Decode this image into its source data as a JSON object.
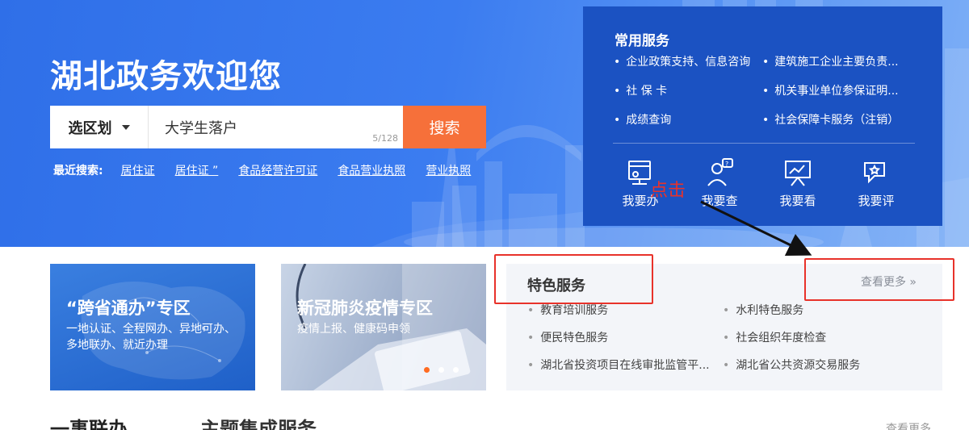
{
  "hero": {
    "title": "湖北政务欢迎您",
    "region_label": "选区划",
    "search_value": "大学生落户",
    "char_counter": "5/128",
    "search_button": "搜索",
    "recent_label": "最近搜索:",
    "recent_items": [
      "居住证",
      "居住证 ”",
      "食品经营许可证",
      "食品营业执照",
      "营业执照"
    ]
  },
  "services": {
    "title": "常用服务",
    "links": [
      "企业政策支持、信息咨询",
      "建筑施工企业主要负责...",
      "社 保 卡",
      "机关事业单位参保证明...",
      "成绩查询",
      "社会保障卡服务（注销）"
    ],
    "actions": [
      "我要办",
      "我要查",
      "我要看",
      "我要评"
    ]
  },
  "annotation": {
    "click_text": "点击",
    "color": "#e8322a"
  },
  "cards": {
    "cross": {
      "title": "“跨省通办”专区",
      "desc": "一地认证、全程网办、异地可办、多地联办、就近办理"
    },
    "covid": {
      "title": "新冠肺炎疫情专区",
      "desc": "疫情上报、健康码申领"
    }
  },
  "feature": {
    "title": "特色服务",
    "more": "查看更多 »",
    "items": [
      "教育培训服务",
      "水利特色服务",
      "便民特色服务",
      "社会组织年度检查",
      "湖北省投资项目在线审批监管平...",
      "湖北省公共资源交易服务"
    ]
  },
  "bottom": {
    "tab1": "一事联办",
    "tab2": "主题集成服务",
    "more": "查看更多"
  },
  "colors": {
    "hero_blue": "#3b7cf0",
    "service_panel": "#1b52c2",
    "search_orange": "#f6703a",
    "accent_dot": "#ff6b21"
  }
}
